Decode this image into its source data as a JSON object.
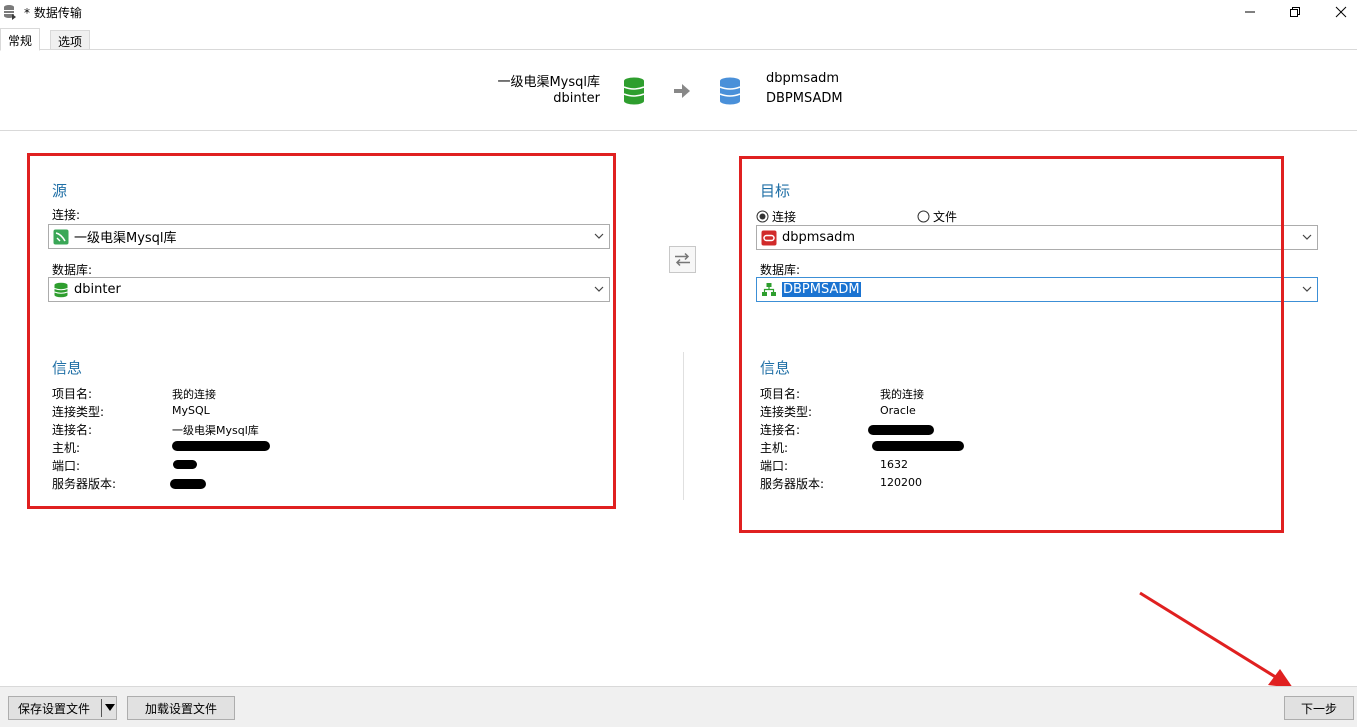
{
  "window": {
    "title": "* 数据传输",
    "icons": {
      "app": "database-transfer-icon",
      "minimize": "minimize-icon",
      "restore": "restore-icon",
      "close": "close-icon"
    }
  },
  "tabs": [
    {
      "label": "常规",
      "active": true
    },
    {
      "label": "选项",
      "active": false
    }
  ],
  "header": {
    "source_connection": "一级电渠Mysql库",
    "source_database": "dbinter",
    "target_connection": "dbpmsadm",
    "target_database": "DBPMSADM"
  },
  "source": {
    "title": "源",
    "connection_label": "连接:",
    "connection_value": "一级电渠Mysql库",
    "database_label": "数据库:",
    "database_value": "dbinter",
    "info_title": "信息",
    "info": [
      {
        "label": "项目名:",
        "value": "我的连接"
      },
      {
        "label": "连接类型:",
        "value": "MySQL"
      },
      {
        "label": "连接名:",
        "value": "一级电渠Mysql库"
      },
      {
        "label": "主机:",
        "value": ""
      },
      {
        "label": "端口:",
        "value": ""
      },
      {
        "label": "服务器版本:",
        "value": ""
      }
    ]
  },
  "swap_button": {
    "icon": "swap-arrows-icon"
  },
  "target": {
    "title": "目标",
    "radio_connection": "连接",
    "radio_file": "文件",
    "radio_selected": "连接",
    "connection_value": "dbpmsadm",
    "database_label": "数据库:",
    "database_value": "DBPMSADM",
    "info_title": "信息",
    "info": [
      {
        "label": "项目名:",
        "value": "我的连接"
      },
      {
        "label": "连接类型:",
        "value": "Oracle"
      },
      {
        "label": "连接名:",
        "value": ""
      },
      {
        "label": "主机:",
        "value": ""
      },
      {
        "label": "端口:",
        "value": "1632"
      },
      {
        "label": "服务器版本:",
        "value": "120200"
      }
    ]
  },
  "footer": {
    "save_settings": "保存设置文件",
    "load_settings": "加载设置文件",
    "next": "下一步"
  },
  "colors": {
    "section_title": "#1f6fa6",
    "highlight_box": "#e02020",
    "mysql_db_green": "#2e9e2e",
    "oracle_db_blue": "#4a90d9",
    "oracle_red": "#d12b2b",
    "selection_blue": "#1a73d1"
  }
}
